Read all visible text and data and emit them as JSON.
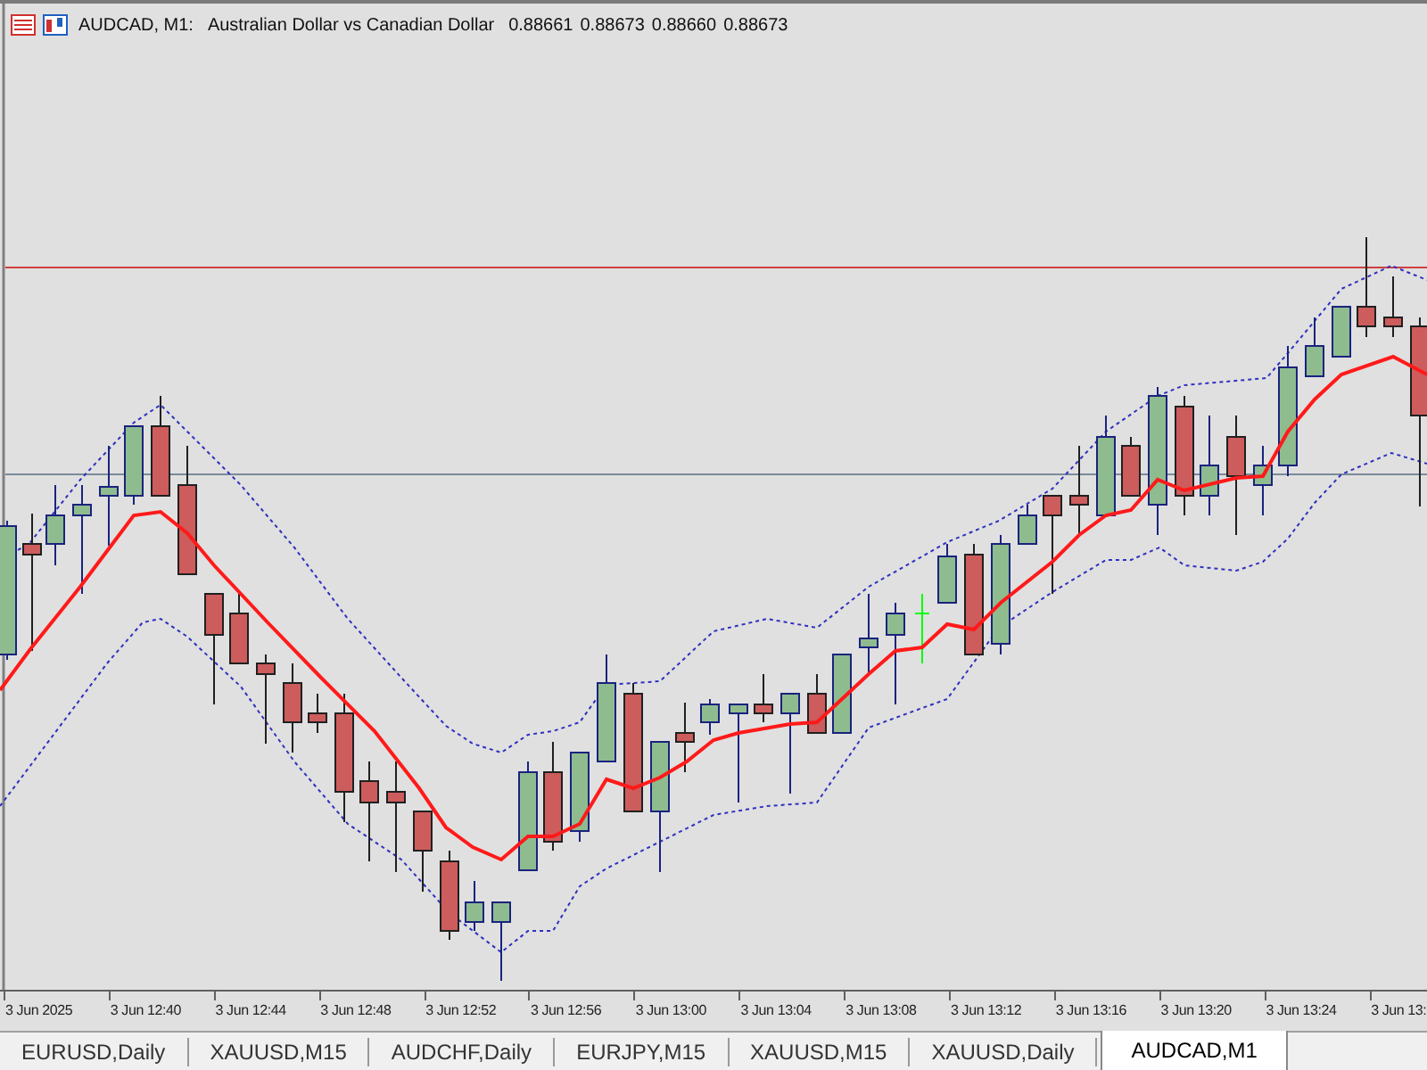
{
  "chart": {
    "symbol": "AUDCAD, M1:",
    "description": "Australian Dollar vs Canadian Dollar",
    "prices": [
      "0.88661",
      "0.88673",
      "0.88660",
      "0.88673"
    ]
  },
  "time_axis": [
    "3 Jun 2025",
    "3 Jun 12:40",
    "3 Jun 12:44",
    "3 Jun 12:48",
    "3 Jun 12:52",
    "3 Jun 12:56",
    "3 Jun 13:00",
    "3 Jun 13:04",
    "3 Jun 13:08",
    "3 Jun 13:12",
    "3 Jun 13:16",
    "3 Jun 13:20",
    "3 Jun 13:24",
    "3 Jun 13:"
  ],
  "tabs": [
    {
      "label": "EURUSD,Daily",
      "selected": false
    },
    {
      "label": "XAUUSD,M15",
      "selected": false
    },
    {
      "label": "AUDCHF,Daily",
      "selected": false
    },
    {
      "label": "EURJPY,M15",
      "selected": false
    },
    {
      "label": "XAUUSD,M15",
      "selected": false
    },
    {
      "label": "XAUUSD,Daily",
      "selected": false
    },
    {
      "label": "AUDCAD,M1",
      "selected": true
    }
  ]
}
